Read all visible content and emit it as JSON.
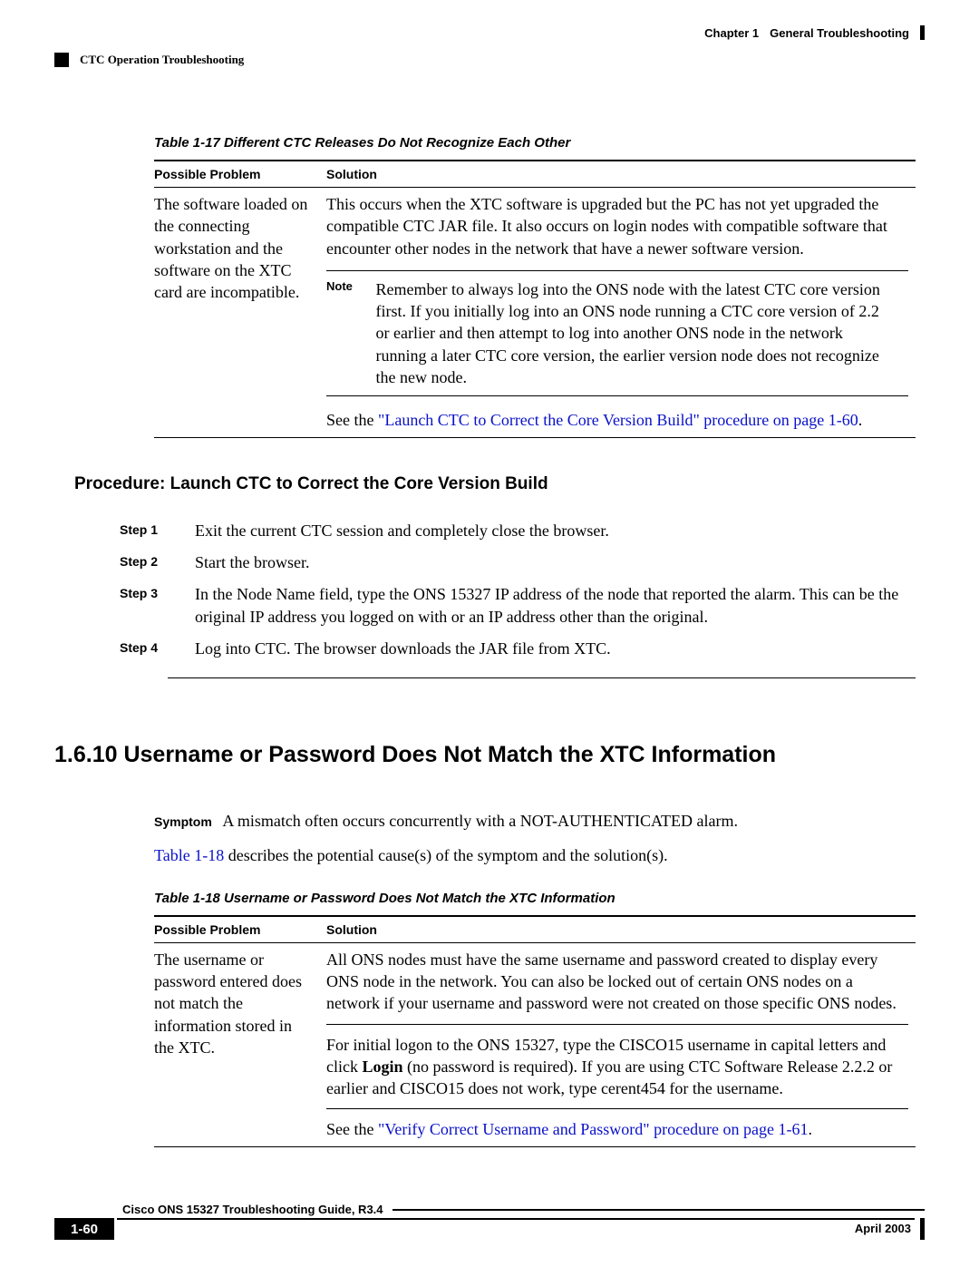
{
  "header": {
    "chapter": "Chapter 1",
    "chapter_title": "General Troubleshooting",
    "section": "CTC Operation Troubleshooting"
  },
  "table17": {
    "caption": "Table 1-17   Different CTC Releases Do Not Recognize Each Other",
    "col1": "Possible Problem",
    "col2": "Solution",
    "problem": "The software loaded on the connecting workstation and the software on the XTC card are incompatible.",
    "solution_p1": "This occurs when the XTC software is upgraded but the PC has not yet upgraded the compatible CTC JAR file. It also occurs on login nodes with compatible software that encounter other nodes in the network that have a newer software version.",
    "note_label": "Note",
    "note_text": "Remember to always log into the ONS node with the latest CTC core version first. If you initially log into an ONS node running a CTC core version of 2.2 or earlier and then attempt to log into another ONS node in the network running a later CTC core version, the earlier version node does not recognize the new node.",
    "see_prefix": "See the ",
    "see_link": "\"Launch CTC to Correct the Core Version Build\" procedure on page 1-60",
    "see_suffix": "."
  },
  "procedure": {
    "heading": "Procedure: Launch CTC to Correct the Core Version Build",
    "steps": [
      {
        "label": "Step 1",
        "text": "Exit the current CTC session and completely close the browser."
      },
      {
        "label": "Step 2",
        "text": "Start the browser."
      },
      {
        "label": "Step 3",
        "text": "In the Node Name field, type the ONS 15327 IP address of the node that reported the alarm. This can be the original IP address you logged on with or an IP address other than the original."
      },
      {
        "label": "Step 4",
        "text": "Log into CTC. The browser downloads the JAR file from XTC."
      }
    ]
  },
  "section1610": {
    "heading": "1.6.10  Username or Password Does Not Match the XTC Information",
    "symptom_label": "Symptom",
    "symptom_text": "A mismatch often occurs concurrently with a NOT-AUTHENTICATED alarm.",
    "desc_prefix": "Table 1-18",
    "desc_suffix": " describes the potential cause(s) of the symptom and the solution(s)."
  },
  "table18": {
    "caption": "Table 1-18   Username or Password Does Not Match the XTC Information",
    "col1": "Possible Problem",
    "col2": "Solution",
    "problem": "The username or password entered does not match the information stored in the XTC.",
    "solution_p1": "All ONS nodes must have the same username and password created to display every ONS node in the network. You can also be locked out of certain ONS nodes on a network if your username and password were not created on those specific ONS nodes.",
    "solution_p2a": "For initial logon to the ONS 15327, type the CISCO15 username in capital letters and click ",
    "solution_p2b": "Login",
    "solution_p2c": " (no password is required). If you are using CTC Software Release 2.2.2 or earlier and CISCO15  does not work, type cerent454 for the username.",
    "see_prefix": "See the ",
    "see_link": "\"Verify Correct Username and Password\" procedure on page 1-61",
    "see_suffix": "."
  },
  "footer": {
    "doc_title": "Cisco ONS 15327 Troubleshooting Guide, R3.4",
    "page": "1-60",
    "date": "April 2003"
  }
}
